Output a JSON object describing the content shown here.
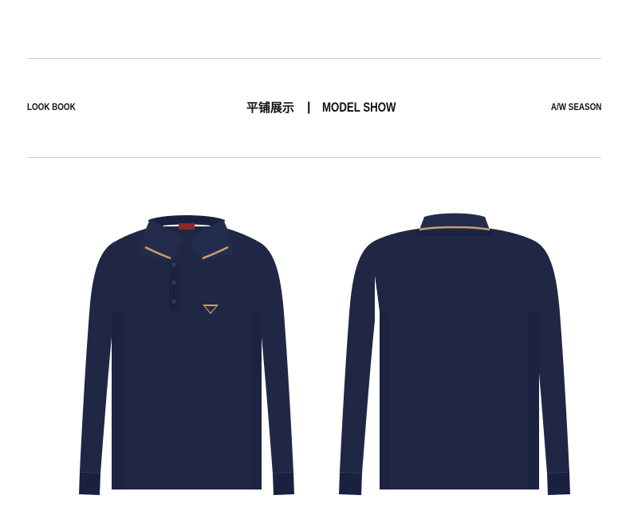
{
  "header": {
    "left_label": "LOOK BOOK",
    "center_cn": "平铺展示",
    "separator": "|",
    "center_en": "MODEL SHOW",
    "right_label": "A/W SEASON"
  },
  "colors": {
    "garment": "#1f2744",
    "garment_shadow": "#161c33",
    "collar_tipping": "#c9a06a",
    "rule": "#cfcfcf"
  },
  "products": [
    {
      "view": "front",
      "icon": "polo-shirt-front-image"
    },
    {
      "view": "back",
      "icon": "polo-shirt-back-image"
    }
  ]
}
